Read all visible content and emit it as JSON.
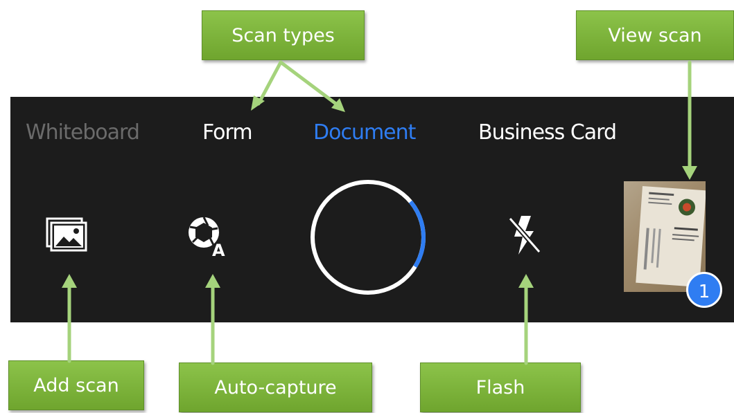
{
  "scan_types": {
    "whiteboard": "Whiteboard",
    "form": "Form",
    "document": "Document",
    "business_card": "Business Card",
    "selected": "Document"
  },
  "callouts": {
    "scan_types": "Scan types",
    "view_scan": "View scan",
    "add_scan": "Add scan",
    "auto_capture": "Auto-capture",
    "flash": "Flash"
  },
  "scan_count": "1",
  "icons": {
    "add_scan": "gallery-icon",
    "auto_capture": "auto-capture-icon",
    "shutter": "shutter-button",
    "flash": "flash-off-icon",
    "thumbnail": "scan-thumbnail"
  },
  "colors": {
    "accent": "#2f7df2",
    "panel": "#1c1c1c",
    "callout": "#7bb43a",
    "inactive": "#6b6b6b"
  },
  "shutter_progress": 0.2
}
